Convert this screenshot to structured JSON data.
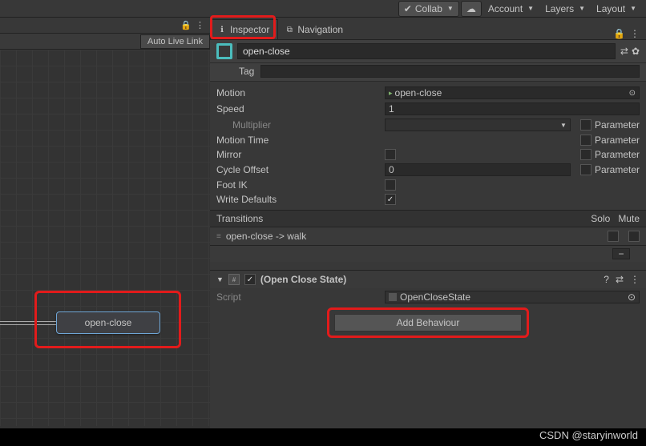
{
  "topbar": {
    "collab": "Collab",
    "account": "Account",
    "layers": "Layers",
    "layout": "Layout"
  },
  "tabs": {
    "inspector": "Inspector",
    "navigation": "Navigation"
  },
  "leftPanel": {
    "autolive": "Auto Live Link"
  },
  "node": {
    "name": "open-close"
  },
  "object": {
    "name": "open-close",
    "tag_label": "Tag"
  },
  "props": {
    "motion": {
      "label": "Motion",
      "value": "open-close"
    },
    "speed": {
      "label": "Speed",
      "value": "1"
    },
    "multiplier": {
      "label": "Multiplier",
      "param": "Parameter"
    },
    "motion_time": {
      "label": "Motion Time",
      "param": "Parameter"
    },
    "mirror": {
      "label": "Mirror",
      "param": "Parameter"
    },
    "cycle_offset": {
      "label": "Cycle Offset",
      "value": "0",
      "param": "Parameter"
    },
    "foot_ik": {
      "label": "Foot IK"
    },
    "write_defaults": {
      "label": "Write Defaults"
    }
  },
  "transitions": {
    "header": "Transitions",
    "solo": "Solo",
    "mute": "Mute",
    "item": "open-close -> walk"
  },
  "script_section": {
    "title": "(Open Close State)",
    "script_label": "Script",
    "script_value": "OpenCloseState",
    "add_behaviour": "Add Behaviour"
  },
  "watermark": "CSDN @staryinworld"
}
